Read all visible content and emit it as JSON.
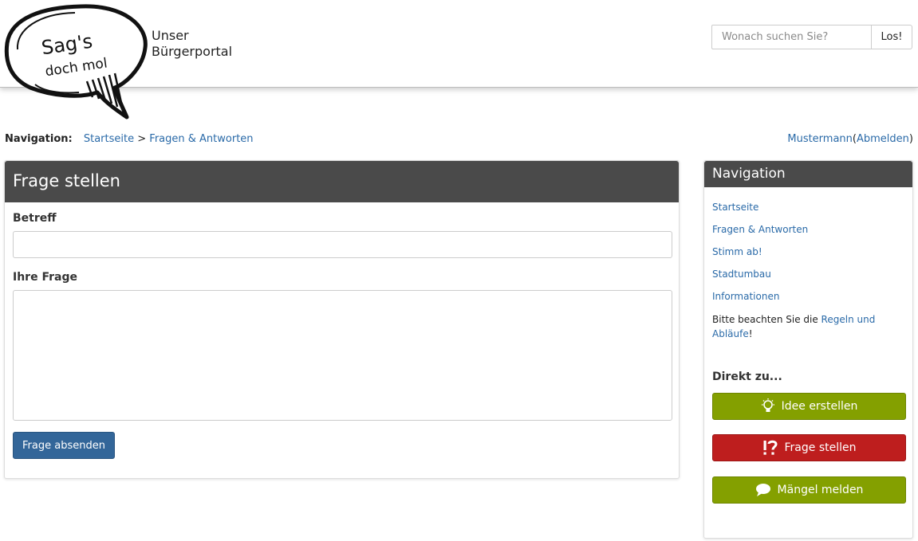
{
  "header": {
    "logo_line1": "Sag's",
    "logo_line2": "doch mol",
    "portal_line1": "Unser",
    "portal_line2": "Bürgerportal",
    "search_placeholder": "Wonach suchen Sie?",
    "search_value": "",
    "search_button": "Los!"
  },
  "breadcrumb": {
    "label": "Navigation:",
    "items": [
      "Startseite",
      "Fragen & Antworten"
    ],
    "separator": ">"
  },
  "user": {
    "name": "Mustermann",
    "open_paren": "(",
    "logout": "Abmelden",
    "close_paren": ")"
  },
  "form": {
    "title": "Frage stellen",
    "subject_label": "Betreff",
    "subject_value": "",
    "question_label": "Ihre Frage",
    "question_value": "",
    "submit_label": "Frage absenden"
  },
  "sidebar": {
    "title": "Navigation",
    "links": [
      "Startseite",
      "Fragen & Antworten",
      "Stimm ab!",
      "Stadtumbau",
      "Informationen"
    ],
    "note_prefix": "Bitte beachten Sie die ",
    "note_link": "Regeln und Abläufe",
    "note_suffix": "!",
    "direct_title": "Direkt zu...",
    "actions": [
      {
        "label": "Idee erstellen",
        "icon": "lightbulb-icon",
        "color": "#84a000"
      },
      {
        "label": "Frage stellen",
        "icon": "exclamation-question-icon",
        "color": "#be1e1e"
      },
      {
        "label": "Mängel melden",
        "icon": "speech-bubble-icon",
        "color": "#84a000"
      }
    ]
  },
  "colors": {
    "panel_header": "#4a4a4a",
    "link": "#2a6aa8",
    "primary_button": "#336699",
    "green_action": "#84a000",
    "red_action": "#be1e1e"
  }
}
